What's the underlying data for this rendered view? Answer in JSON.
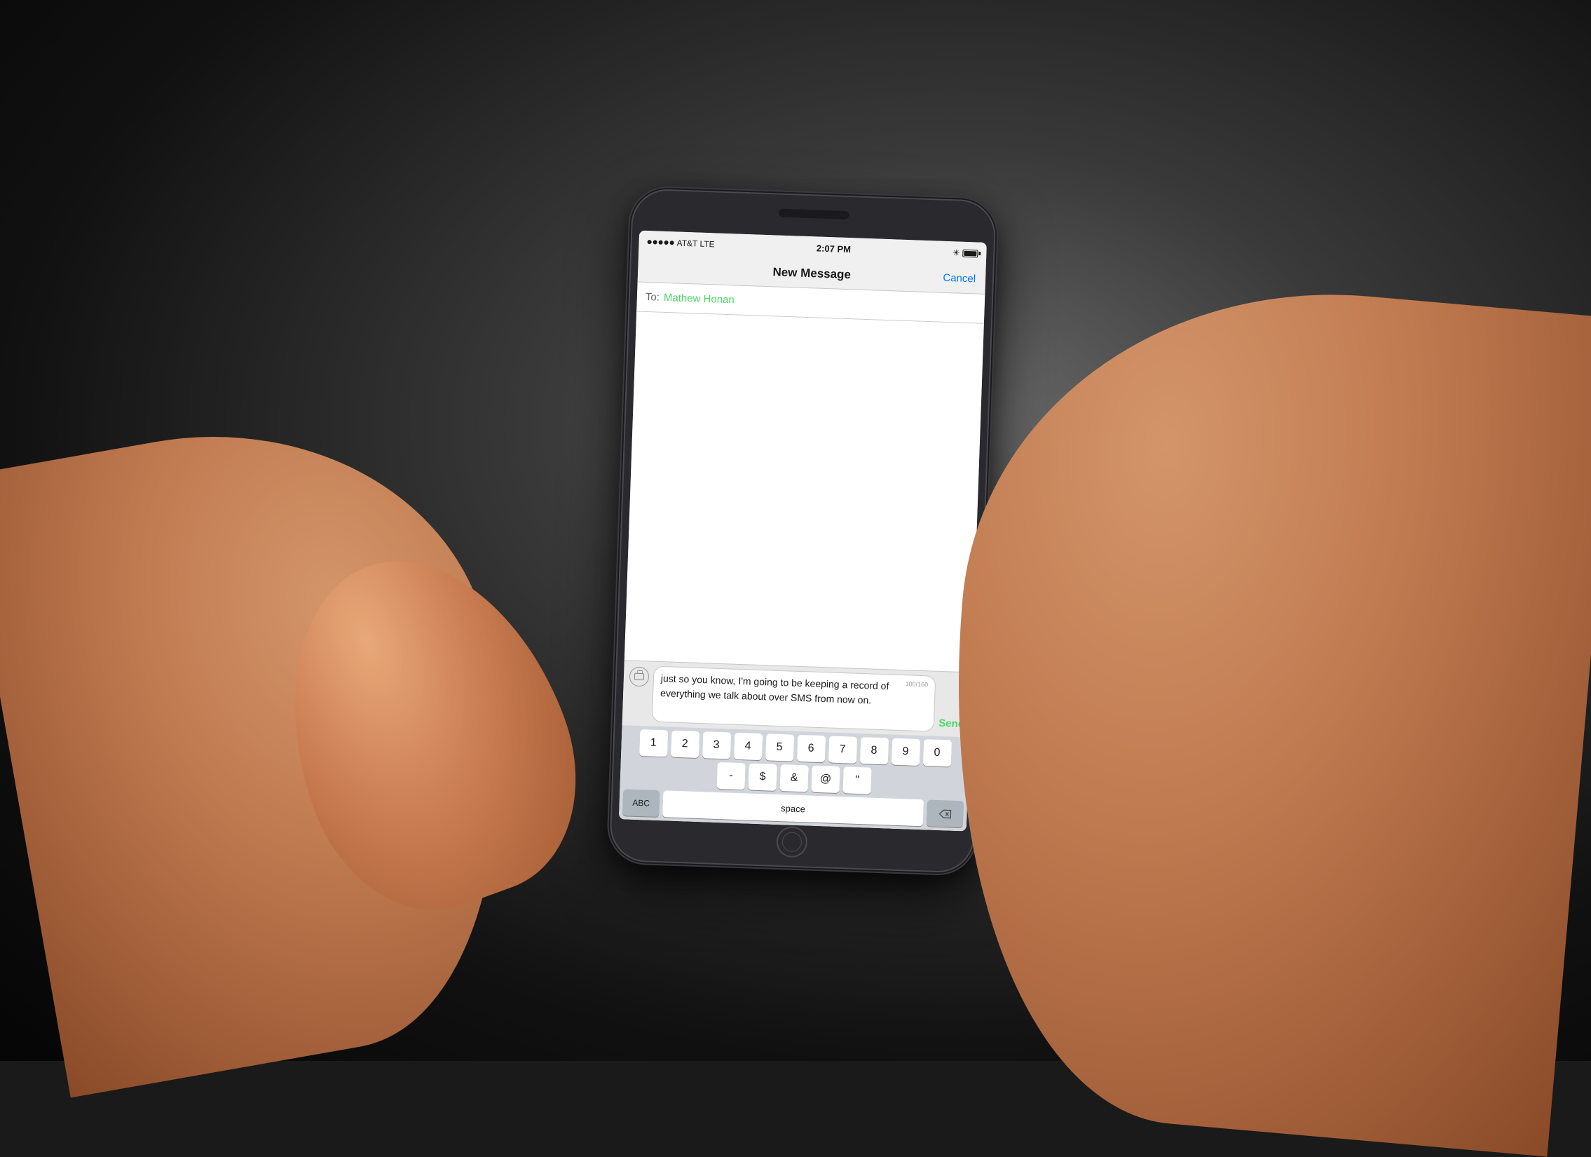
{
  "background": {
    "color": "#1a1a1a"
  },
  "status_bar": {
    "carrier": "AT&T LTE",
    "time": "2:07 PM",
    "bluetooth_symbol": "✳",
    "battery_label": "battery"
  },
  "nav_bar": {
    "title": "New Message",
    "cancel_label": "Cancel"
  },
  "to_field": {
    "label": "To:",
    "recipient": "Mathew Honan"
  },
  "compose": {
    "char_count": "100/160",
    "message_text": "just so you know, I'm going to be keeping a record of everything we talk about over SMS from now on.",
    "send_label": "Send"
  },
  "keyboard": {
    "row1": [
      "1",
      "2",
      "3",
      "4",
      "5",
      "6",
      "7",
      "8",
      "9",
      "0"
    ],
    "row2": [
      "-",
      "$",
      "&",
      "@",
      "\""
    ],
    "row3": [
      "ABC",
      "⌫"
    ],
    "bottom_label": "ABC"
  }
}
